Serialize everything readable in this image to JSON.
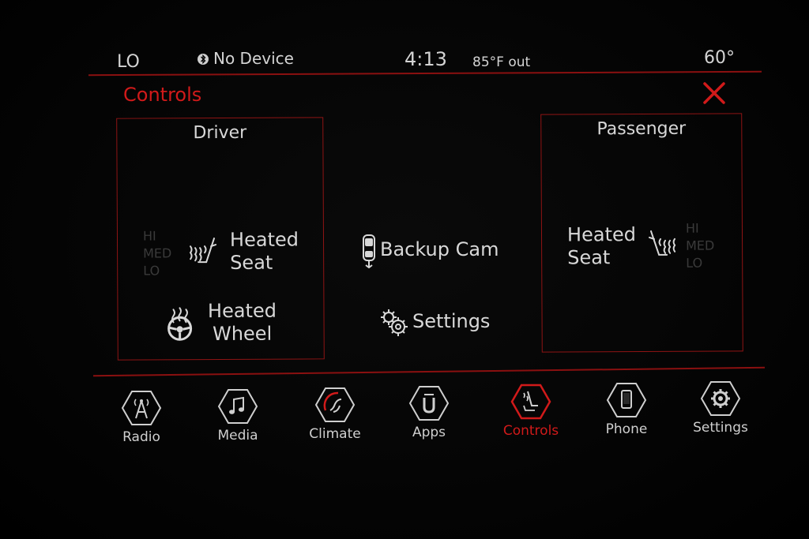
{
  "status_bar": {
    "left_temp": "LO",
    "bluetooth": "No Device",
    "time": "4:13",
    "outside_temp": "85°F out",
    "right_temp": "60°"
  },
  "header": {
    "title": "Controls",
    "close_icon": "close-x-icon"
  },
  "driver": {
    "title": "Driver",
    "levels": [
      "HI",
      "MED",
      "LO"
    ],
    "heated_seat": [
      "Heated",
      "Seat"
    ],
    "heated_wheel": [
      "Heated",
      "Wheel"
    ]
  },
  "center": {
    "backup_cam": "Backup Cam",
    "settings": "Settings"
  },
  "passenger": {
    "title": "Passenger",
    "levels": [
      "HI",
      "MED",
      "LO"
    ],
    "heated_seat": [
      "Heated",
      "Seat"
    ]
  },
  "nav": {
    "items": [
      {
        "label": "Radio",
        "icon": "radio-tower-icon"
      },
      {
        "label": "Media",
        "icon": "music-note-icon"
      },
      {
        "label": "Climate",
        "icon": "climate-icon"
      },
      {
        "label": "Apps",
        "icon": "apps-u-icon"
      },
      {
        "label": "Controls",
        "icon": "controls-seat-icon",
        "active": true
      },
      {
        "label": "Phone",
        "icon": "phone-icon"
      },
      {
        "label": "Settings",
        "icon": "gear-icon"
      }
    ]
  },
  "colors": {
    "accent": "#d11a1a",
    "panel_border": "#8f1414",
    "text": "#d8d8d8",
    "inactive_level": "#3a3a3a"
  }
}
